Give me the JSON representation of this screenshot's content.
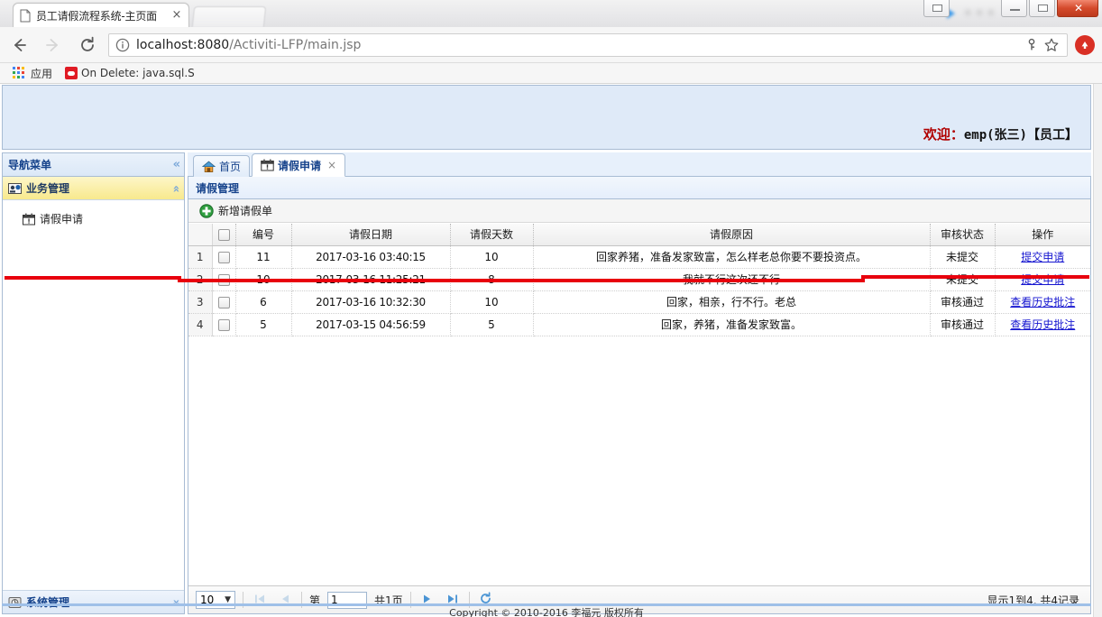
{
  "browser": {
    "tab": {
      "title": "员工请假流程系统-主页面",
      "favicon": "page-icon",
      "close": "×"
    },
    "nav": {
      "back": "back-arrow-icon",
      "forward": "forward-arrow-icon",
      "reload": "reload-icon"
    },
    "omnibox": {
      "info_icon": "info-circle-icon",
      "host": "localhost:8080",
      "path": "/Activiti-LFP/main.jsp",
      "full_url": "localhost:8080/Activiti-LFP/main.jsp",
      "key_icon": "password-key-icon",
      "star_icon": "bookmark-star-icon",
      "profile_icon": "profile-avatar-icon"
    },
    "bookmarks": [
      {
        "label": "应用",
        "icon": "apps-grid-icon"
      },
      {
        "label": "On Delete: java.sql.S",
        "icon": "sql-red-icon",
        "fade": ".S"
      }
    ],
    "window_controls": {
      "minimize": "minimize-icon",
      "maximize": "maximize-icon",
      "close": "✕"
    }
  },
  "header": {
    "welcome_label": "欢迎：",
    "welcome_user": "emp(张三)【员工】"
  },
  "sidebar": {
    "title": "导航菜单",
    "collapse_icon": "«",
    "groups": [
      {
        "label": "业务管理",
        "icon": "business-group-icon",
        "state_icon": "«",
        "expanded": true,
        "items": [
          {
            "label": "请假申请",
            "icon": "calendar-leave-icon"
          }
        ]
      },
      {
        "label": "系统管理",
        "icon": "system-group-icon",
        "state_icon": "»",
        "expanded": false,
        "items": []
      }
    ]
  },
  "tabs": [
    {
      "label": "首页",
      "icon": "home-icon",
      "active": false,
      "closable": false
    },
    {
      "label": "请假申请",
      "icon": "calendar-leave-icon",
      "active": true,
      "closable": true,
      "close": "×"
    }
  ],
  "panel": {
    "title": "请假管理",
    "toolbar": [
      {
        "label": "新增请假单",
        "icon": "add-plus-icon"
      }
    ]
  },
  "table": {
    "columns": [
      {
        "key": "rownum",
        "label": "",
        "cls": "c-num"
      },
      {
        "key": "check",
        "label": "",
        "cls": "c-chk"
      },
      {
        "key": "id",
        "label": "编号",
        "cls": "c-id"
      },
      {
        "key": "date",
        "label": "请假日期",
        "cls": "c-date"
      },
      {
        "key": "days",
        "label": "请假天数",
        "cls": "c-days"
      },
      {
        "key": "reason",
        "label": "请假原因",
        "cls": "c-reason"
      },
      {
        "key": "status",
        "label": "审核状态",
        "cls": "c-status"
      },
      {
        "key": "op",
        "label": "操作",
        "cls": "c-op"
      }
    ],
    "rows": [
      {
        "rownum": "1",
        "id": "11",
        "date": "2017-03-16 03:40:15",
        "days": "10",
        "reason": "回家养猪，准备发家致富，怎么样老总你要不要投资点。",
        "status": "未提交",
        "op": "提交申请",
        "highlighted": true
      },
      {
        "rownum": "2",
        "id": "10",
        "date": "2017-03-16 11:25:21",
        "days": "8",
        "reason": "我就不行这次还不行",
        "status": "未提交",
        "op": "提交申请",
        "highlighted": false
      },
      {
        "rownum": "3",
        "id": "6",
        "date": "2017-03-16 10:32:30",
        "days": "10",
        "reason": "回家，相亲，行不行。老总",
        "status": "审核通过",
        "op": "查看历史批注",
        "highlighted": false
      },
      {
        "rownum": "4",
        "id": "5",
        "date": "2017-03-15 04:56:59",
        "days": "5",
        "reason": "回家，养猪，准备发家致富。",
        "status": "审核通过",
        "op": "查看历史批注",
        "highlighted": false
      }
    ],
    "annotation_color": "#e8000d"
  },
  "pager": {
    "page_size": "10",
    "page_size_caret": "▼",
    "first_icon": "first-page-icon",
    "prev_icon": "prev-page-icon",
    "page_prefix": "第",
    "page_value": "1",
    "page_suffix": "共1页",
    "next_icon": "next-page-icon",
    "last_icon": "last-page-icon",
    "refresh_icon": "refresh-icon",
    "info": "显示1到4, 共4记录"
  },
  "footer": {
    "copyright": "Copyright © 2010-2016 李福元 版权所有"
  },
  "colors": {
    "accent": "#15428b",
    "banner_bg": "#dfeaf8",
    "accordion_active": "#f8e98d",
    "link": "#1616d0",
    "annotation": "#e8000d"
  }
}
